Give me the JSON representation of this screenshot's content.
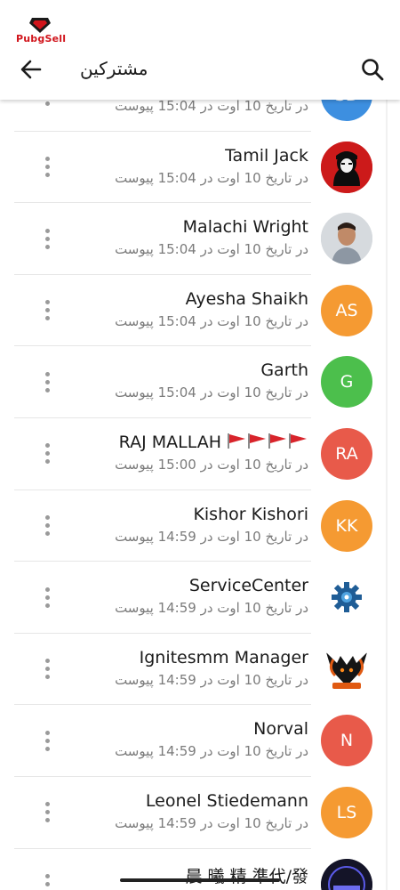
{
  "brand": {
    "name": "PubgSell"
  },
  "header": {
    "title": "مشترکین",
    "back_icon": "arrow-back-icon",
    "search_icon": "search-icon"
  },
  "subscribers": [
    {
      "name": "",
      "meta": "در تاریخ 10 اوت در 15:04 پیوست",
      "initials": "SD",
      "avatar_color": "#3d8fe0",
      "avatar_type": "initials"
    },
    {
      "name": "Tamil Jack",
      "meta": "در تاریخ 10 اوت در 15:04 پیوست",
      "initials": "",
      "avatar_color": "#cc1a1a",
      "avatar_type": "photo-portrait"
    },
    {
      "name": "Malachi Wright",
      "meta": "در تاریخ 10 اوت در 15:04 پیوست",
      "initials": "",
      "avatar_color": "#cfd3d8",
      "avatar_type": "photo-person"
    },
    {
      "name": "Ayesha Shaikh",
      "meta": "در تاریخ 10 اوت در 15:04 پیوست",
      "initials": "AS",
      "avatar_color": "#f59a32",
      "avatar_type": "initials"
    },
    {
      "name": "Garth",
      "meta": "در تاریخ 10 اوت در 15:04 پیوست",
      "initials": "G",
      "avatar_color": "#4cbf4c",
      "avatar_type": "initials"
    },
    {
      "name": "RAJ MALLAH",
      "meta": "در تاریخ 10 اوت در 15:00 پیوست",
      "initials": "RA",
      "avatar_color": "#e85a4a",
      "avatar_type": "initials",
      "flags": 4
    },
    {
      "name": "Kishor Kishori",
      "meta": "در تاریخ 10 اوت در 14:59 پیوست",
      "initials": "KK",
      "avatar_color": "#f59a32",
      "avatar_type": "initials"
    },
    {
      "name": "ServiceCenter",
      "meta": "در تاریخ 10 اوت در 14:59 پیوست",
      "initials": "",
      "avatar_color": "#ffffff",
      "avatar_type": "gear-logo"
    },
    {
      "name": "Ignitesmm Manager",
      "meta": "در تاریخ 10 اوت در 14:59 پیوست",
      "initials": "",
      "avatar_color": "#ffffff",
      "avatar_type": "ignite-logo"
    },
    {
      "name": "Norval",
      "meta": "در تاریخ 10 اوت در 14:59 پیوست",
      "initials": "N",
      "avatar_color": "#e85a4a",
      "avatar_type": "initials"
    },
    {
      "name": "Leonel Stiedemann",
      "meta": "در تاریخ 10 اوت در 14:59 پیوست",
      "initials": "LS",
      "avatar_color": "#f59a32",
      "avatar_type": "initials"
    },
    {
      "name": "晨 曦 精 準代/發",
      "meta": "",
      "initials": "",
      "avatar_color": "#141428",
      "avatar_type": "dark-logo"
    }
  ]
}
